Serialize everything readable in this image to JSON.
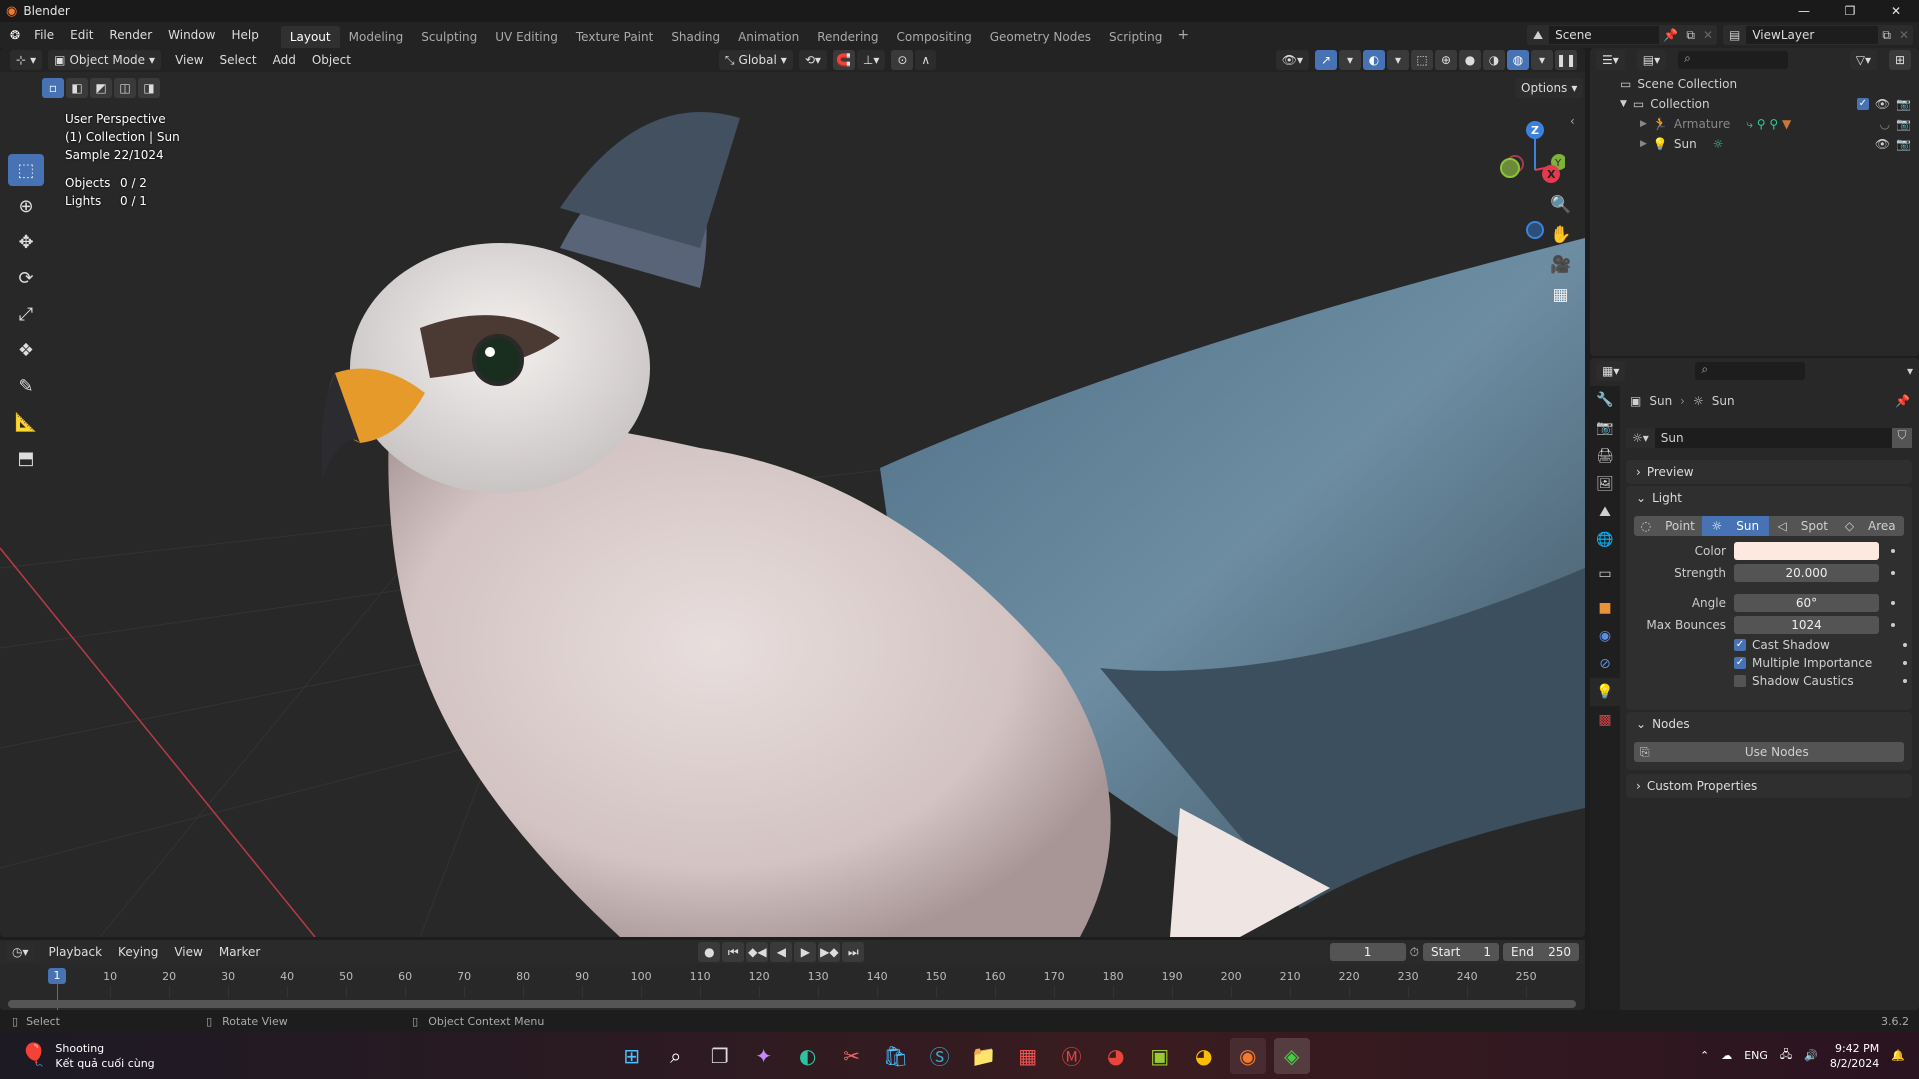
{
  "window": {
    "title": "Blender"
  },
  "menu": [
    "File",
    "Edit",
    "Render",
    "Window",
    "Help"
  ],
  "workspaces": [
    "Layout",
    "Modeling",
    "Sculpting",
    "UV Editing",
    "Texture Paint",
    "Shading",
    "Animation",
    "Rendering",
    "Compositing",
    "Geometry Nodes",
    "Scripting"
  ],
  "active_workspace": "Layout",
  "add_workspace": "+",
  "scene": {
    "name": "Scene",
    "view_layer": "ViewLayer"
  },
  "viewport_header": {
    "mode": "Object Mode",
    "menus": [
      "View",
      "Select",
      "Add",
      "Object"
    ],
    "orientation": "Global",
    "options": "Options"
  },
  "overlay": {
    "view": "User Perspective",
    "context": "(1) Collection | Sun",
    "sample": "Sample 22/1024",
    "objects_label": "Objects",
    "objects_value": "0 / 2",
    "lights_label": "Lights",
    "lights_value": "0 / 1"
  },
  "gizmo": {
    "z": "Z",
    "x": "X",
    "y": "Y"
  },
  "outliner": {
    "root": "Scene Collection",
    "collection": "Collection",
    "items": [
      "Armature",
      "Sun"
    ]
  },
  "properties": {
    "breadcrumb": [
      "Sun",
      "Sun"
    ],
    "datablock": "Sun",
    "panels": {
      "preview": "Preview",
      "light": "Light",
      "nodes": "Nodes",
      "custom": "Custom Properties"
    },
    "light_types": [
      "Point",
      "Sun",
      "Spot",
      "Area"
    ],
    "active_type": "Sun",
    "color_label": "Color",
    "color_value": "#fde9e0",
    "strength_label": "Strength",
    "strength": "20.000",
    "angle_label": "Angle",
    "angle": "60°",
    "bounces_label": "Max Bounces",
    "bounces": "1024",
    "cast_shadow": "Cast Shadow",
    "multiple_importance": "Multiple Importance",
    "shadow_caustics": "Shadow Caustics",
    "use_nodes": "Use Nodes"
  },
  "timeline": {
    "menus": [
      "Playback",
      "Keying",
      "View",
      "Marker"
    ],
    "current_frame": "1",
    "start_label": "Start",
    "start": "1",
    "end_label": "End",
    "end": "250",
    "ticks": [
      "10",
      "20",
      "30",
      "40",
      "50",
      "60",
      "70",
      "80",
      "90",
      "100",
      "110",
      "120",
      "130",
      "140",
      "150",
      "160",
      "170",
      "180",
      "190",
      "200",
      "210",
      "220",
      "230",
      "240",
      "250"
    ]
  },
  "status": {
    "select": "Select",
    "rotate": "Rotate View",
    "context_menu": "Object Context Menu",
    "version": "3.6.2"
  },
  "taskbar": {
    "notif_title": "Shooting",
    "notif_sub": "Kết quả cuối cùng",
    "lang": "ENG",
    "time": "9:42 PM",
    "date": "8/2/2024"
  }
}
